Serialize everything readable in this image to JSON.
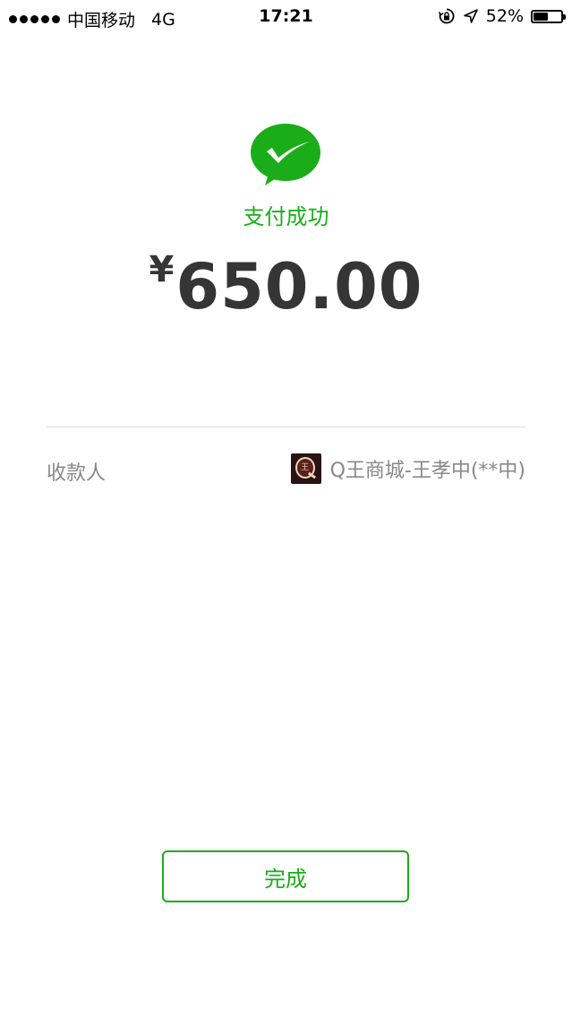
{
  "status_bar": {
    "carrier": "中国移动",
    "network": "4G",
    "time": "17:21",
    "battery_percent": "52%",
    "battery_level": 0.52,
    "icons": [
      "rotation-lock-icon",
      "location-arrow-icon",
      "battery-icon"
    ]
  },
  "payment": {
    "status_text": "支付成功",
    "currency_symbol": "¥",
    "amount": "650.00",
    "icon": "wechat-pay-success-icon"
  },
  "payee": {
    "label": "收款人",
    "name": "Q王商城-王孝中(**中)",
    "logo_text": "王"
  },
  "actions": {
    "done_label": "完成"
  },
  "colors": {
    "accent_green": "#1aad19",
    "amount_text": "#353535",
    "secondary_text": "#888888"
  }
}
